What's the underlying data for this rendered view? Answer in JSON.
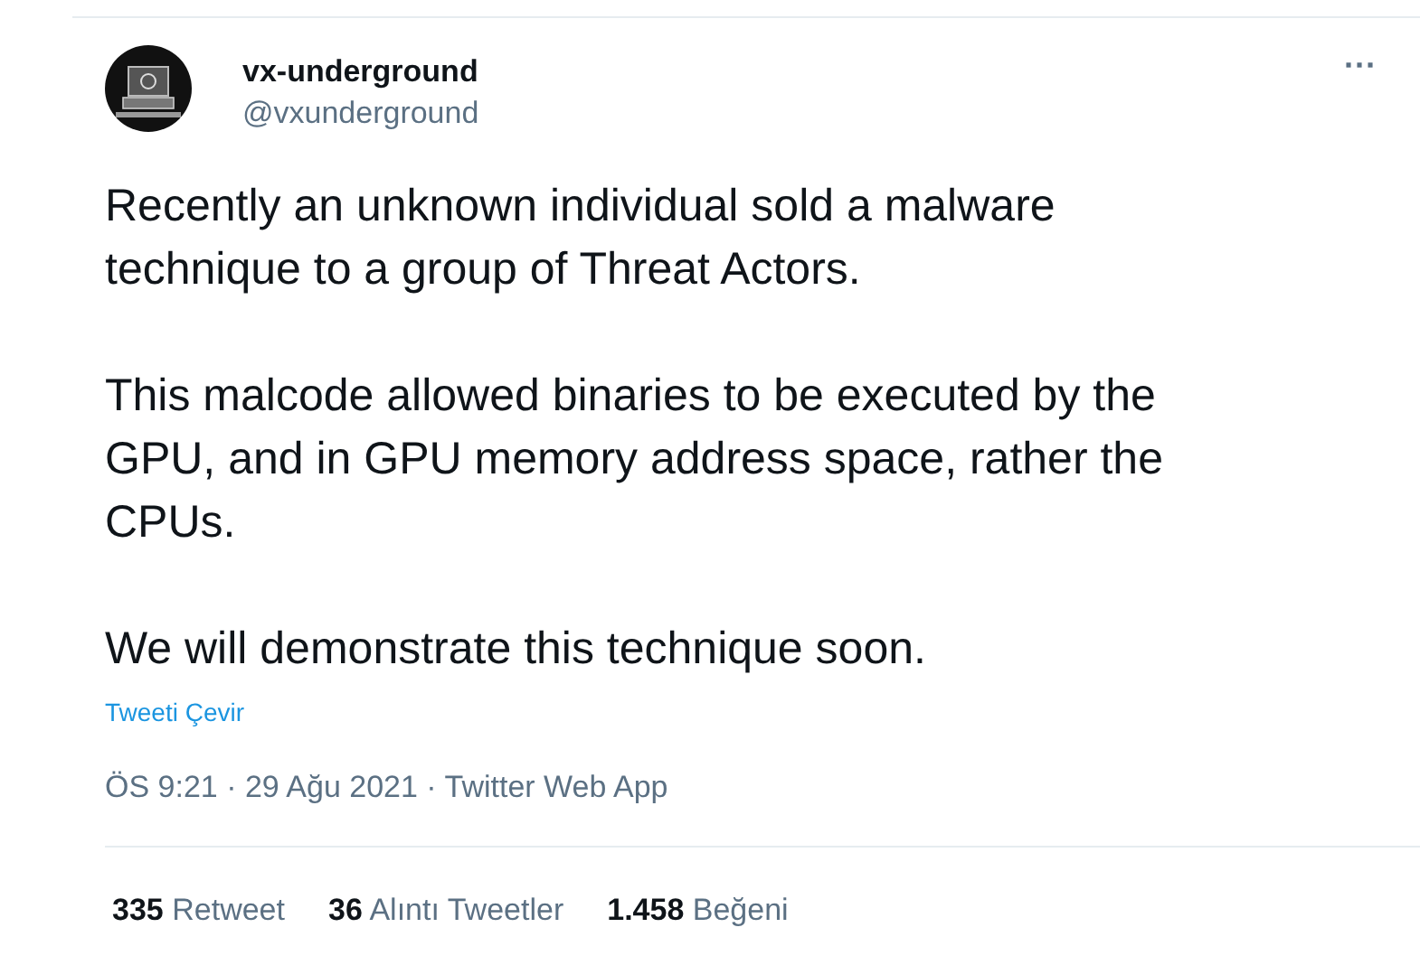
{
  "author": {
    "name": "vx-underground",
    "handle": "@vxunderground"
  },
  "more": "···",
  "paragraphs": [
    [
      "Recently an unknown individual sold a malware",
      "technique to a group of Threat Actors."
    ],
    [
      "This malcode allowed binaries to be executed by the",
      "GPU, and in GPU memory address space, rather the",
      "CPUs."
    ],
    [
      "We will demonstrate this technique soon."
    ]
  ],
  "translate": "Tweeti Çevir",
  "timestamp": "ÖS 9:21 · 29 Ağu 2021 · Twitter Web App",
  "stats": [
    {
      "count": "335",
      "label": "Retweet"
    },
    {
      "count": "36",
      "label": "Alıntı Tweetler"
    },
    {
      "count": "1.458",
      "label": "Beğeni"
    }
  ]
}
